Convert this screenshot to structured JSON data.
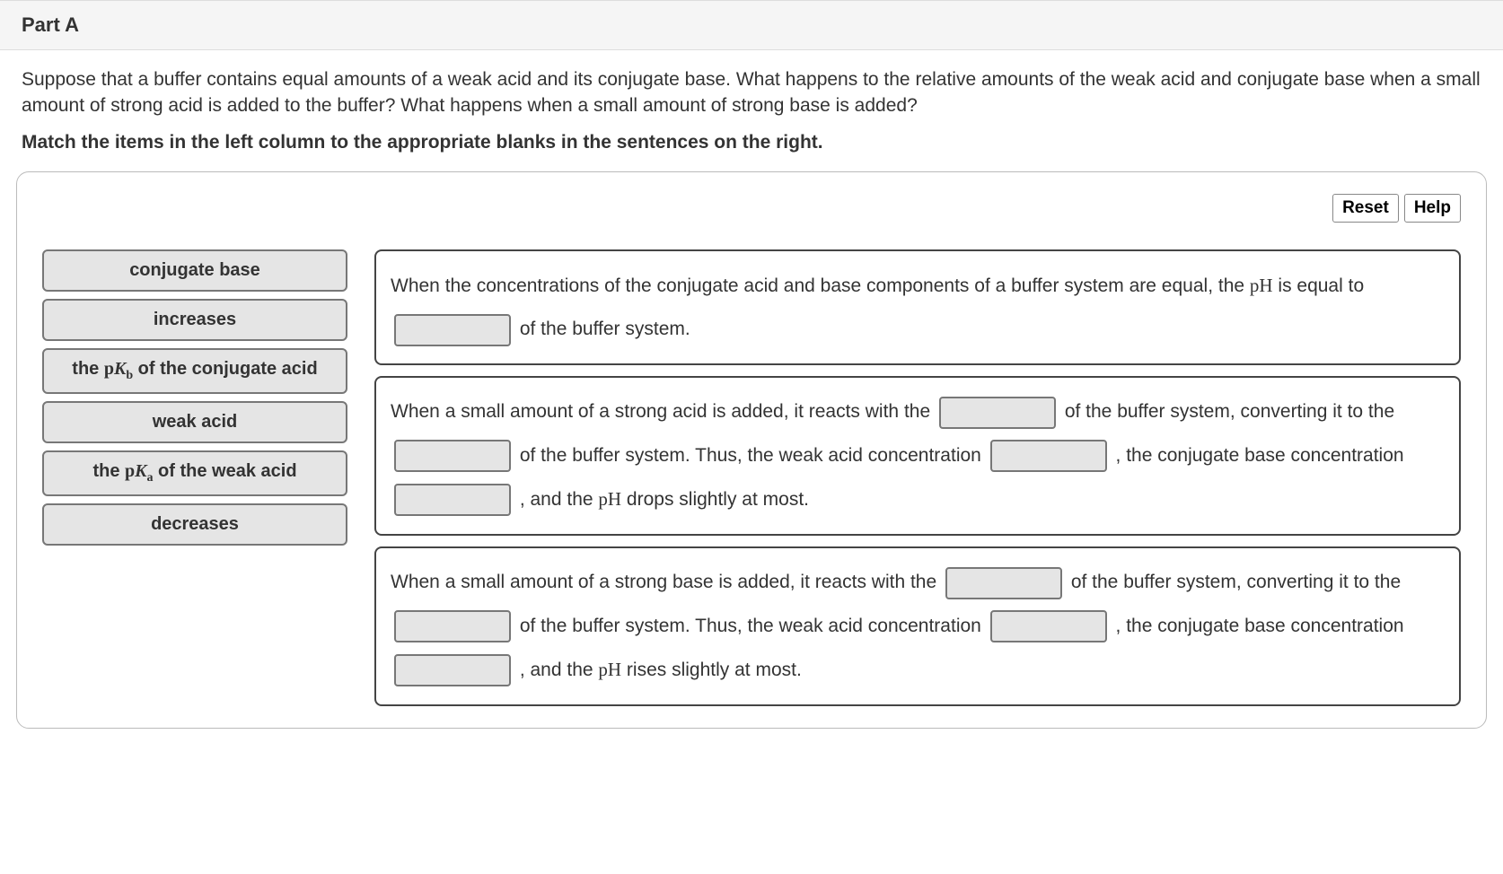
{
  "header": {
    "title": "Part A"
  },
  "question": {
    "prompt": "Suppose that a buffer contains equal amounts of a weak acid and its conjugate base. What happens to the relative amounts of the weak acid and conjugate base when a small amount of strong acid is added to the buffer? What happens when a small amount of strong base is added?",
    "instruction": "Match the items in the left column to the appropriate blanks in the sentences on the right."
  },
  "buttons": {
    "reset": "Reset",
    "help": "Help"
  },
  "drag_items": [
    "conjugate base",
    "increases",
    "the pKb of the conjugate acid",
    "weak acid",
    "the pKa of the weak acid",
    "decreases"
  ],
  "sentences": {
    "s1": {
      "t1": "When the concentrations of the conjugate acid and base components of a buffer system are equal, the ",
      "pH": "pH",
      "t2": " is equal to ",
      "t3": " of the buffer system."
    },
    "s2": {
      "t1": "When a small amount of a strong acid is added, it reacts with the ",
      "t2": " of the buffer system, converting it to the ",
      "t3": " of the buffer system. Thus, the weak acid concentration ",
      "t4": " , the conjugate base concentration ",
      "t5": " , and the ",
      "pH": "pH",
      "t6": " drops slightly at most."
    },
    "s3": {
      "t1": "When a small amount of a strong base is added, it reacts with the ",
      "t2": " of the buffer system, converting it to the ",
      "t3": " of the buffer system. Thus, the weak acid concentration ",
      "t4": " , the conjugate base concentration ",
      "t5": " , and the ",
      "pH": "pH",
      "t6": " rises slightly at most."
    }
  },
  "formula_parts": {
    "p": "p",
    "K": "K",
    "b": "b",
    "a": "a",
    "the": "the ",
    "pka_suffix": " of the weak acid",
    "pkb_suffix": " of the conjugate acid"
  }
}
